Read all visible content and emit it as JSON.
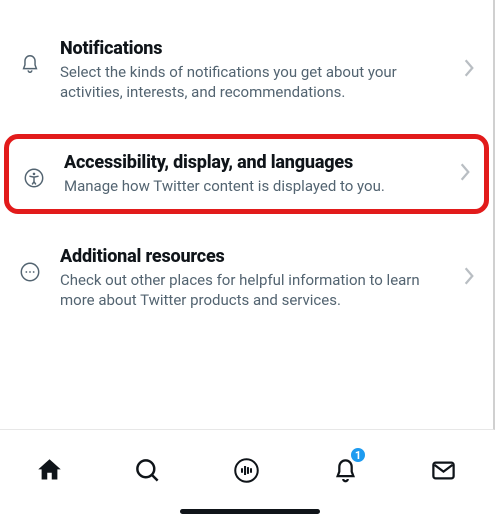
{
  "settings": [
    {
      "icon": "bell-icon",
      "title": "Notifications",
      "desc": "Select the kinds of notifications you get about your activities, interests, and recommendations."
    },
    {
      "icon": "accessibility-icon",
      "title": "Accessibility, display, and languages",
      "desc": "Manage how Twitter content is displayed to you.",
      "highlighted": true
    },
    {
      "icon": "more-circle-icon",
      "title": "Additional resources",
      "desc": "Check out other places for helpful information to learn more about Twitter products and services."
    }
  ],
  "nav": {
    "home": "Home",
    "search": "Search",
    "spaces": "Spaces",
    "notifications": "Notifications",
    "messages": "Messages",
    "notification_count": "1"
  }
}
